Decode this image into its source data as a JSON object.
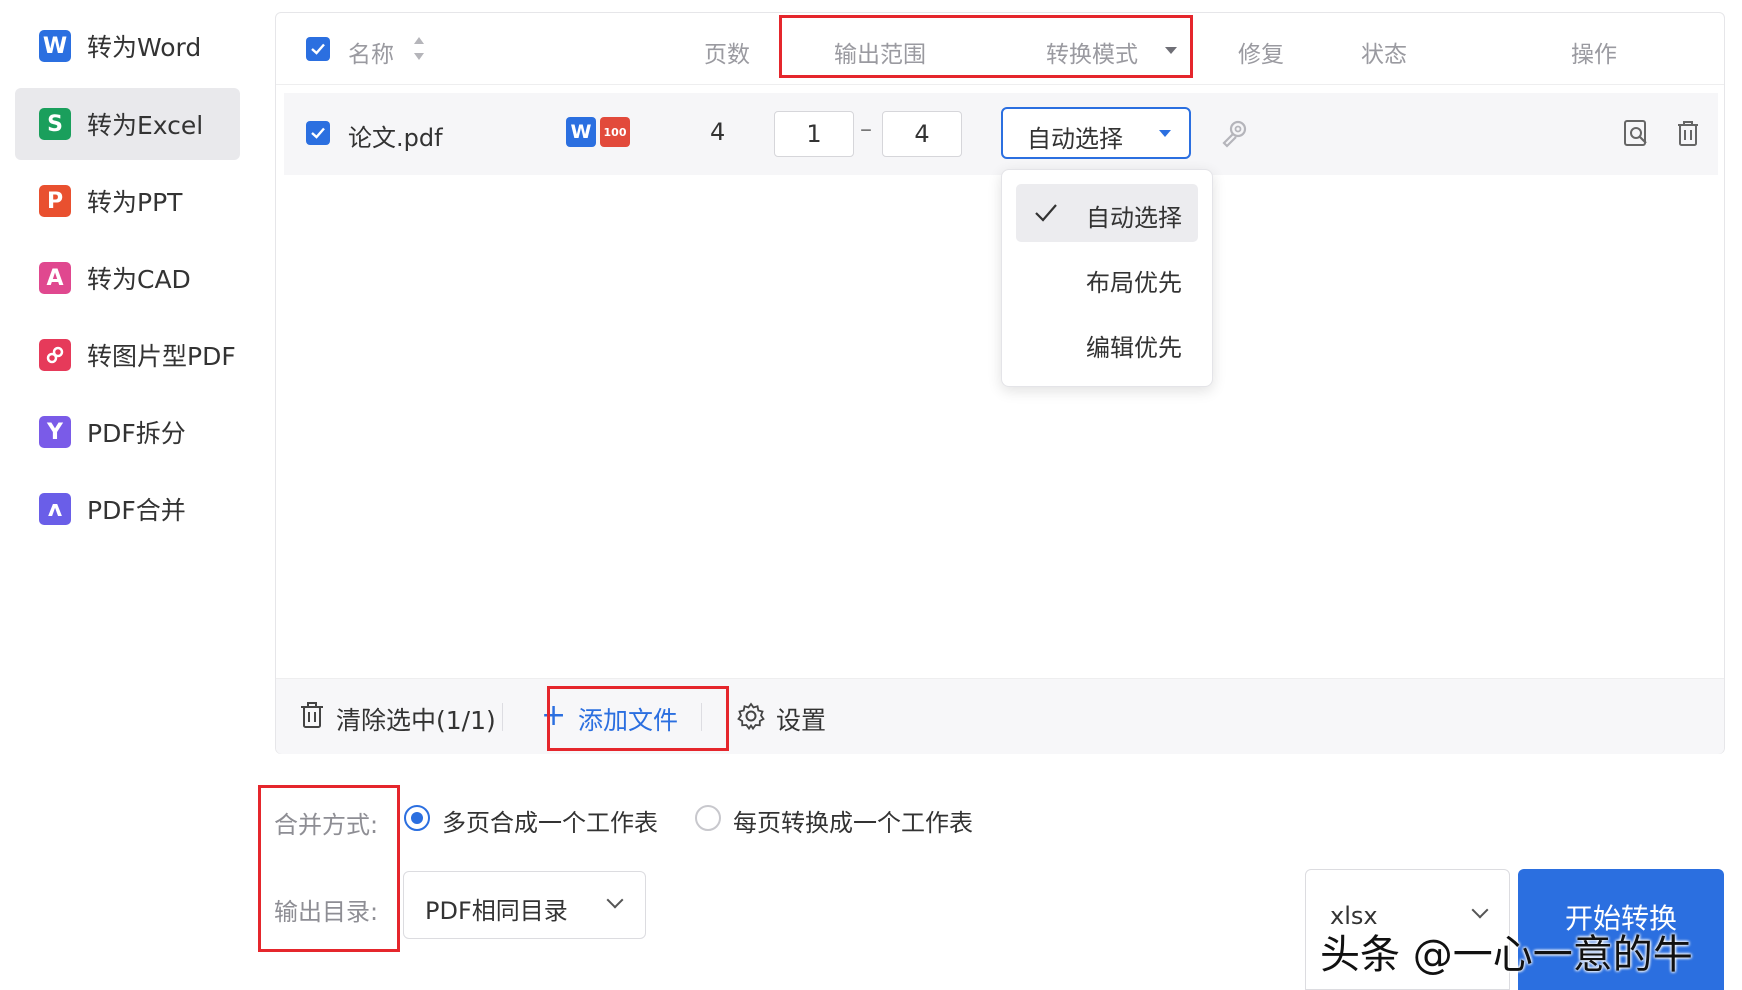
{
  "sidebar": {
    "items": [
      {
        "label": "转为Word",
        "icon": "W",
        "color": "#2b6fe0"
      },
      {
        "label": "转为Excel",
        "icon": "S",
        "color": "#1a9f5c"
      },
      {
        "label": "转为PPT",
        "icon": "P",
        "color": "#e9502f"
      },
      {
        "label": "转为CAD",
        "icon": "A",
        "color": "#e0488f"
      },
      {
        "label": "转图片型PDF",
        "icon": "🔗",
        "color": "#e63a5a"
      },
      {
        "label": "PDF拆分",
        "icon": "Y",
        "color": "#7a5be8"
      },
      {
        "label": "PDF合并",
        "icon": "ᴧ",
        "color": "#6a5ee8"
      }
    ],
    "active_index": 1
  },
  "table": {
    "headers": {
      "name": "名称",
      "pages": "页数",
      "range": "输出范围",
      "mode": "转换模式",
      "repair": "修复",
      "status": "状态",
      "actions": "操作"
    },
    "row": {
      "filename": "论文.pdf",
      "pages": "4",
      "range_from": "1",
      "range_sep": "–",
      "range_to": "4",
      "mode": "自动选择"
    }
  },
  "mode_dropdown": {
    "options": [
      "自动选择",
      "布局优先",
      "编辑优先"
    ],
    "selected": "自动选择"
  },
  "footer": {
    "clear": "清除选中(1/1)",
    "add": "添加文件",
    "settings": "设置"
  },
  "options": {
    "merge_label": "合并方式:",
    "merge_option1": "多页合成一个工作表",
    "merge_option2": "每页转换成一个工作表",
    "output_label": "输出目录:",
    "output_dir": "PDF相同目录",
    "format": "xlsx",
    "start": "开始转换"
  },
  "watermark": "头条 @一心一意的牛",
  "colors": {
    "accent": "#2b6fe0",
    "highlight": "#e5262c"
  }
}
